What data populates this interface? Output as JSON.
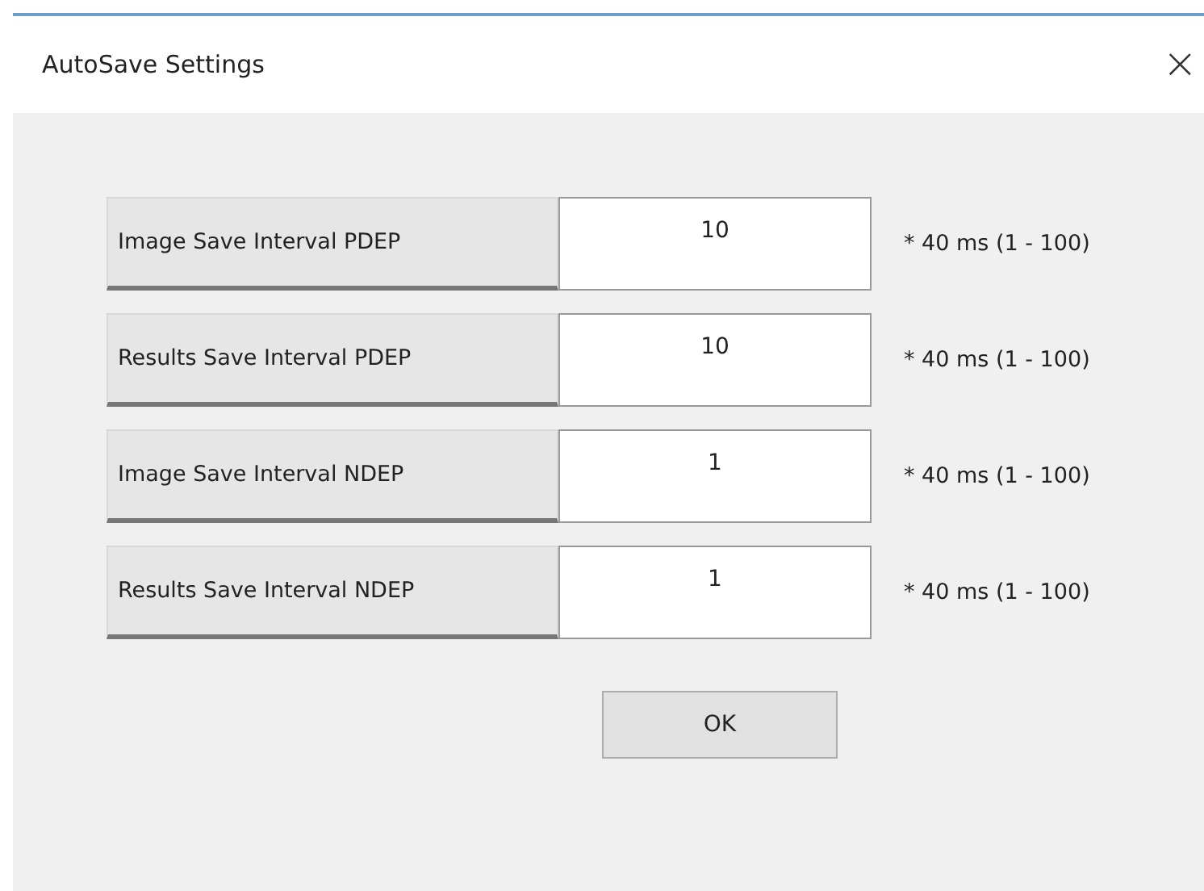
{
  "window": {
    "title": "AutoSave Settings",
    "close": "×"
  },
  "rows": [
    {
      "label": "Image Save Interval PDEP",
      "value": "10",
      "unit": "* 40 ms (1 - 100)"
    },
    {
      "label": "Results Save Interval PDEP",
      "value": "10",
      "unit": "* 40 ms (1 - 100)"
    },
    {
      "label": "Image Save Interval NDEP",
      "value": "1",
      "unit": "* 40 ms (1 - 100)"
    },
    {
      "label": "Results Save Interval NDEP",
      "value": "1",
      "unit": "* 40 ms (1 - 100)"
    }
  ],
  "buttons": [
    "OK"
  ]
}
